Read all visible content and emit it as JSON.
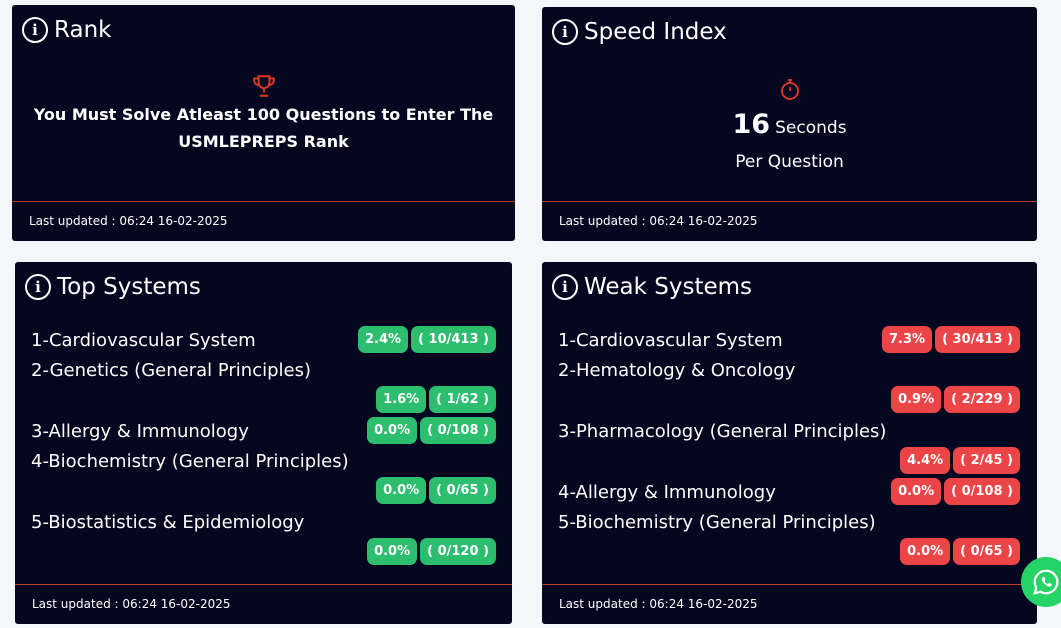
{
  "rank": {
    "title": "Rank",
    "message_line1": "You Must Solve Atleast 100 Questions to Enter The",
    "message_line2": "USMLEPREPS Rank",
    "footer": "Last updated : 06:24 16-02-2025"
  },
  "speed": {
    "title": "Speed Index",
    "value": "16",
    "unit": "Seconds",
    "per": "Per Question",
    "footer": "Last updated : 06:24 16-02-2025"
  },
  "top_systems": {
    "title": "Top Systems",
    "footer": "Last updated : 06:24 16-02-2025",
    "items": [
      {
        "name": "1-Cardiovascular System",
        "pct": "2.4%",
        "count": "( 10/413 )"
      },
      {
        "name": "2-Genetics (General Principles)",
        "pct": "1.6%",
        "count": "( 1/62 )"
      },
      {
        "name": "3-Allergy & Immunology",
        "pct": "0.0%",
        "count": "( 0/108 )"
      },
      {
        "name": "4-Biochemistry (General Principles)",
        "pct": "0.0%",
        "count": "( 0/65 )"
      },
      {
        "name": "5-Biostatistics & Epidemiology",
        "pct": "0.0%",
        "count": "( 0/120 )"
      }
    ]
  },
  "weak_systems": {
    "title": "Weak Systems",
    "footer": "Last updated : 06:24 16-02-2025",
    "items": [
      {
        "name": "1-Cardiovascular System",
        "pct": "7.3%",
        "count": "( 30/413 )"
      },
      {
        "name": "2-Hematology & Oncology",
        "pct": "0.9%",
        "count": "( 2/229 )"
      },
      {
        "name": "3-Pharmacology (General Principles)",
        "pct": "4.4%",
        "count": "( 2/45 )"
      },
      {
        "name": "4-Allergy & Immunology",
        "pct": "0.0%",
        "count": "( 0/108 )"
      },
      {
        "name": "5-Biochemistry (General Principles)",
        "pct": "0.0%",
        "count": "( 0/65 )"
      }
    ]
  },
  "colors": {
    "card_bg": "#05061f",
    "good": "#2dbd6e",
    "bad": "#ec4548",
    "accent": "#e0392b",
    "whatsapp": "#25d366"
  }
}
